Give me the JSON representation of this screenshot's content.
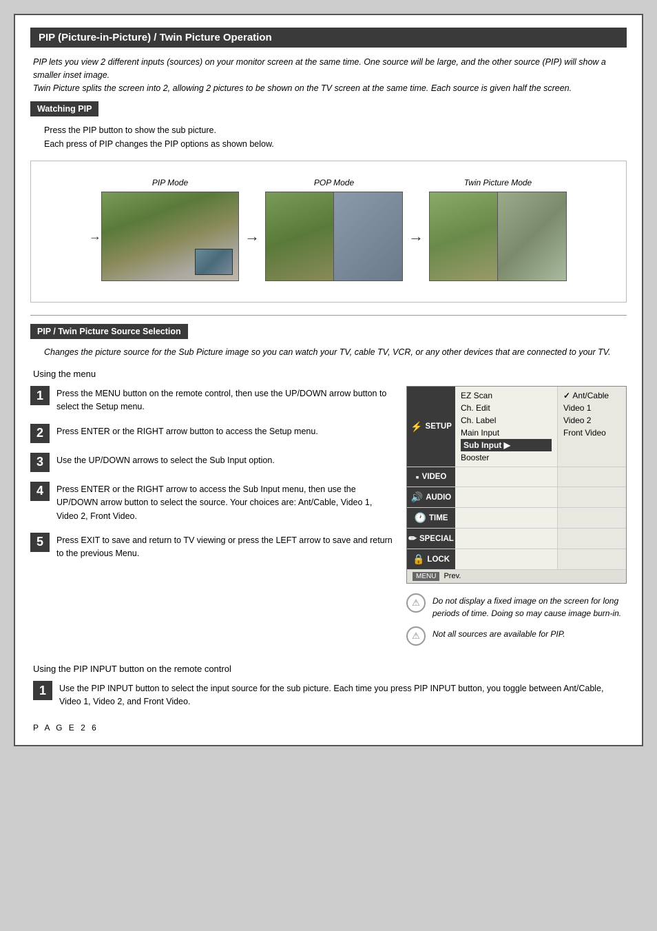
{
  "page": {
    "title": "PIP (Picture-in-Picture) / Twin Picture Operation",
    "intro1": "PIP lets you view 2 different inputs (sources) on your monitor screen at the same time. One source will be large, and the other source (PIP) will show a smaller inset image.",
    "intro2": "Twin Picture splits the screen into 2, allowing 2 pictures to be shown on the TV screen at the same time. Each source is given half the screen.",
    "watching_pip_header": "Watching PIP",
    "watching_pip_text1": "Press the PIP button to show the sub picture.",
    "watching_pip_text2": "Each press of PIP changes the PIP options as shown below.",
    "pip_label": "PIP Mode",
    "pop_label": "POP Mode",
    "twin_label": "Twin Picture Mode",
    "twin_section_header": "PIP / Twin Picture Source Selection",
    "twin_section_desc": "Changes the picture source for the Sub Picture image so you can watch your TV, cable TV, VCR, or any other devices that are connected to your TV.",
    "using_menu": "Using the menu",
    "steps": [
      {
        "num": "1",
        "text": "Press the MENU button on the remote control, then use the UP/DOWN arrow button to select the Setup menu."
      },
      {
        "num": "2",
        "text": "Press ENTER or the RIGHT arrow button to access the Setup menu."
      },
      {
        "num": "3",
        "text": "Use the UP/DOWN arrows to select the Sub Input option."
      },
      {
        "num": "4",
        "text": "Press ENTER or the RIGHT arrow to access the Sub Input menu, then use the UP/DOWN arrow button to select the source. Your choices are: Ant/Cable, Video 1, Video 2, Front Video."
      },
      {
        "num": "5",
        "text": "Press EXIT to save and return to TV viewing or press the LEFT arrow to save and return to the previous Menu."
      }
    ],
    "menu": {
      "items": [
        {
          "icon": "⚡",
          "label": "SETUP",
          "menu_items": [
            "EZ Scan",
            "Ch. Edit",
            "Ch. Label",
            "Main Input",
            "Sub Input",
            "Booster"
          ]
        },
        {
          "icon": "▪",
          "label": "VIDEO",
          "menu_items": []
        },
        {
          "icon": "🔊",
          "label": "AUDIO",
          "menu_items": []
        },
        {
          "icon": "🕐",
          "label": "TIME",
          "menu_items": []
        },
        {
          "icon": "✏️",
          "label": "SPECIAL",
          "menu_items": []
        },
        {
          "icon": "🔒",
          "label": "LOCK",
          "menu_items": []
        }
      ],
      "sub_items": [
        "✓ Ant/Cable",
        "Video 1",
        "Video 2",
        "Front Video"
      ],
      "footer_menu": "MENU",
      "footer_prev": "Prev."
    },
    "notes": [
      "Do not display a fixed image on the screen for long periods of  time. Doing so may cause image burn-in.",
      "Not all sources are available for PIP."
    ],
    "using_pip_input": "Using the PIP INPUT button on the remote control",
    "step1_pip": {
      "num": "1",
      "text": "Use the PIP INPUT button to select the input source for the sub picture.\nEach time you press PIP INPUT button, you toggle between Ant/Cable, Video 1, Video 2, and Front Video."
    },
    "page_number": "P A G E   2 6"
  }
}
